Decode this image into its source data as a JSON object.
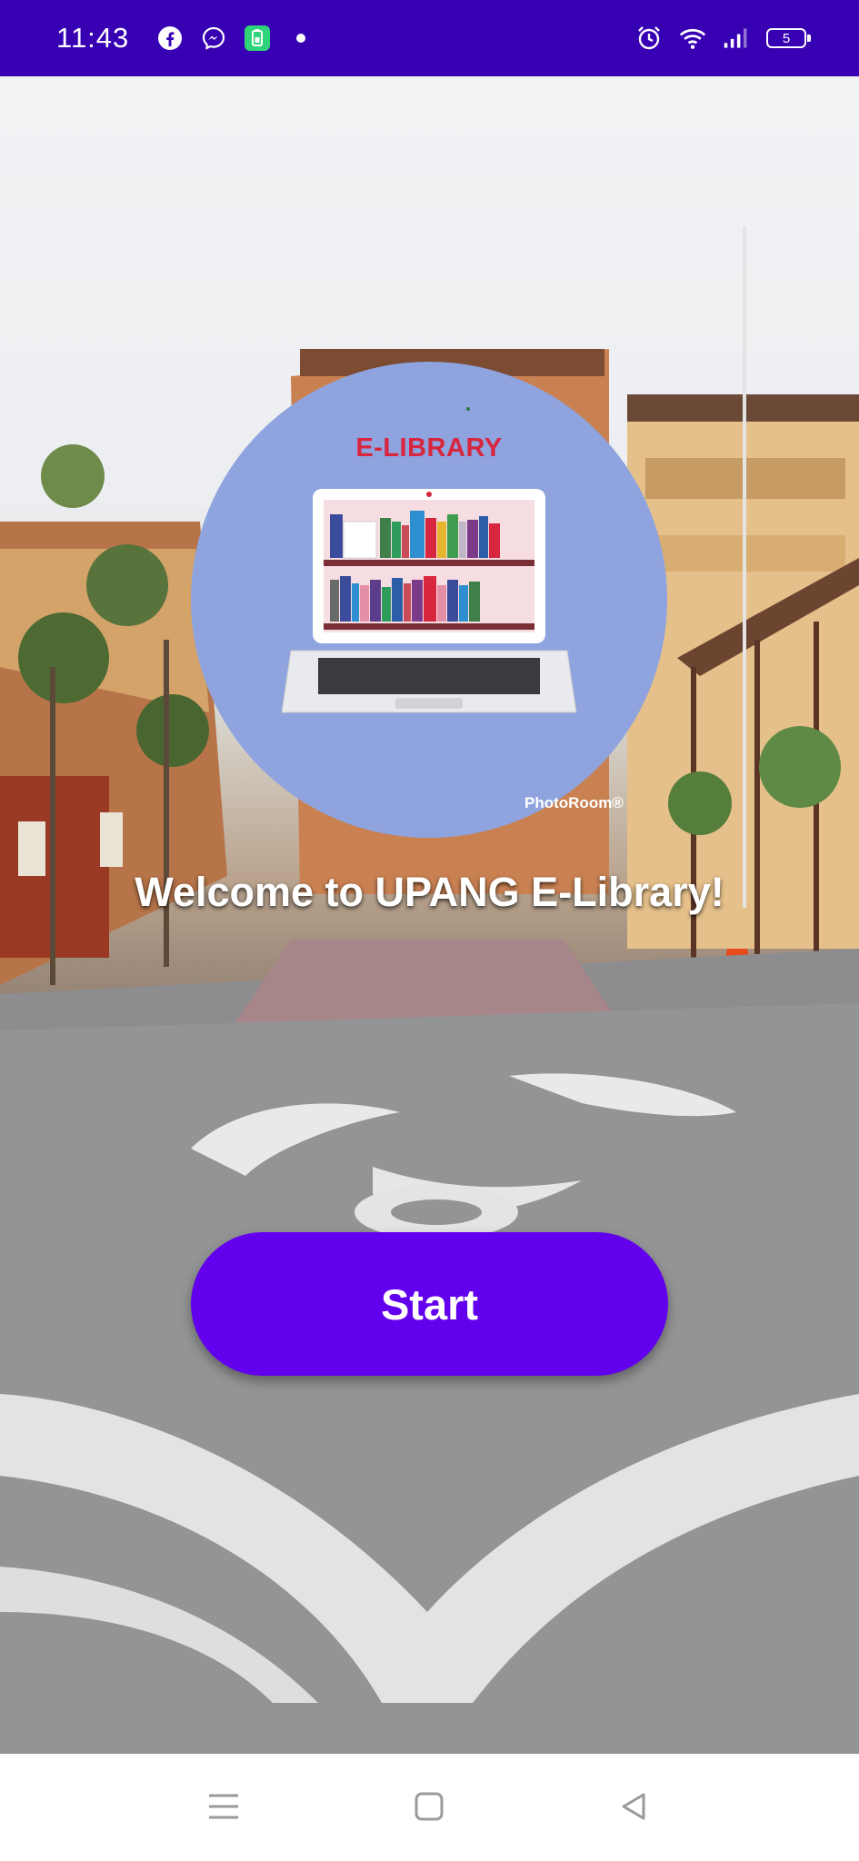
{
  "status_bar": {
    "time": "11:43",
    "battery_level": "5",
    "left_icons": [
      "facebook-icon",
      "messenger-icon",
      "battery-saver-icon",
      "dot-icon"
    ],
    "right_icons": [
      "alarm-icon",
      "wifi-icon",
      "signal-icon",
      "battery-icon"
    ]
  },
  "logo": {
    "title": "E-LIBRARY",
    "watermark": "PhotoRoom®"
  },
  "welcome_text": "Welcome to UPANG E-Library!",
  "start_button": {
    "label": "Start"
  },
  "nav_bar": {
    "buttons": [
      "menu-icon",
      "home-icon",
      "back-icon"
    ]
  },
  "colors": {
    "status_bar": "#3700b3",
    "button": "#6200ee",
    "logo_circle": "#8fa3de",
    "logo_title": "#d7263d"
  }
}
